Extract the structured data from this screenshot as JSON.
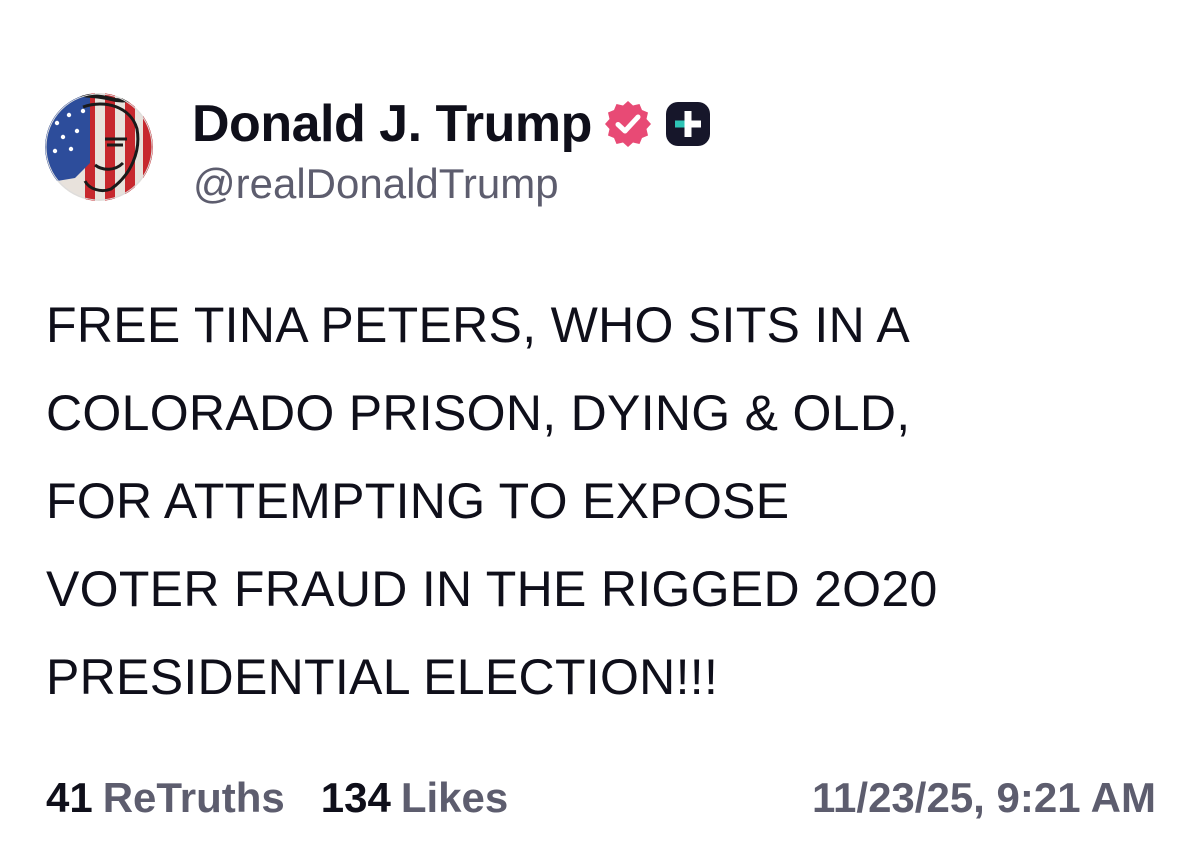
{
  "post": {
    "author": {
      "display_name": "Donald J. Trump",
      "handle": "@realDonaldTrump",
      "verified_color": "#e84a75",
      "badge_color": "#16162a"
    },
    "text_lines": [
      "FREE TINA PETERS, WHO SITS IN A",
      "COLORADO PRISON, DYING & OLD,",
      "FOR ATTEMPTING TO EXPOSE",
      "VOTER FRAUD IN THE RIGGED 2O20",
      "PRESIDENTIAL ELECTION!!!"
    ],
    "stats": {
      "retruths_count": "41",
      "retruths_label": "ReTruths",
      "likes_count": "134",
      "likes_label": "Likes"
    },
    "timestamp": "11/23/25, 9:21 AM"
  },
  "colors": {
    "text_primary": "#0f0f1a",
    "text_secondary": "#5d5d6e",
    "background": "#ffffff"
  }
}
